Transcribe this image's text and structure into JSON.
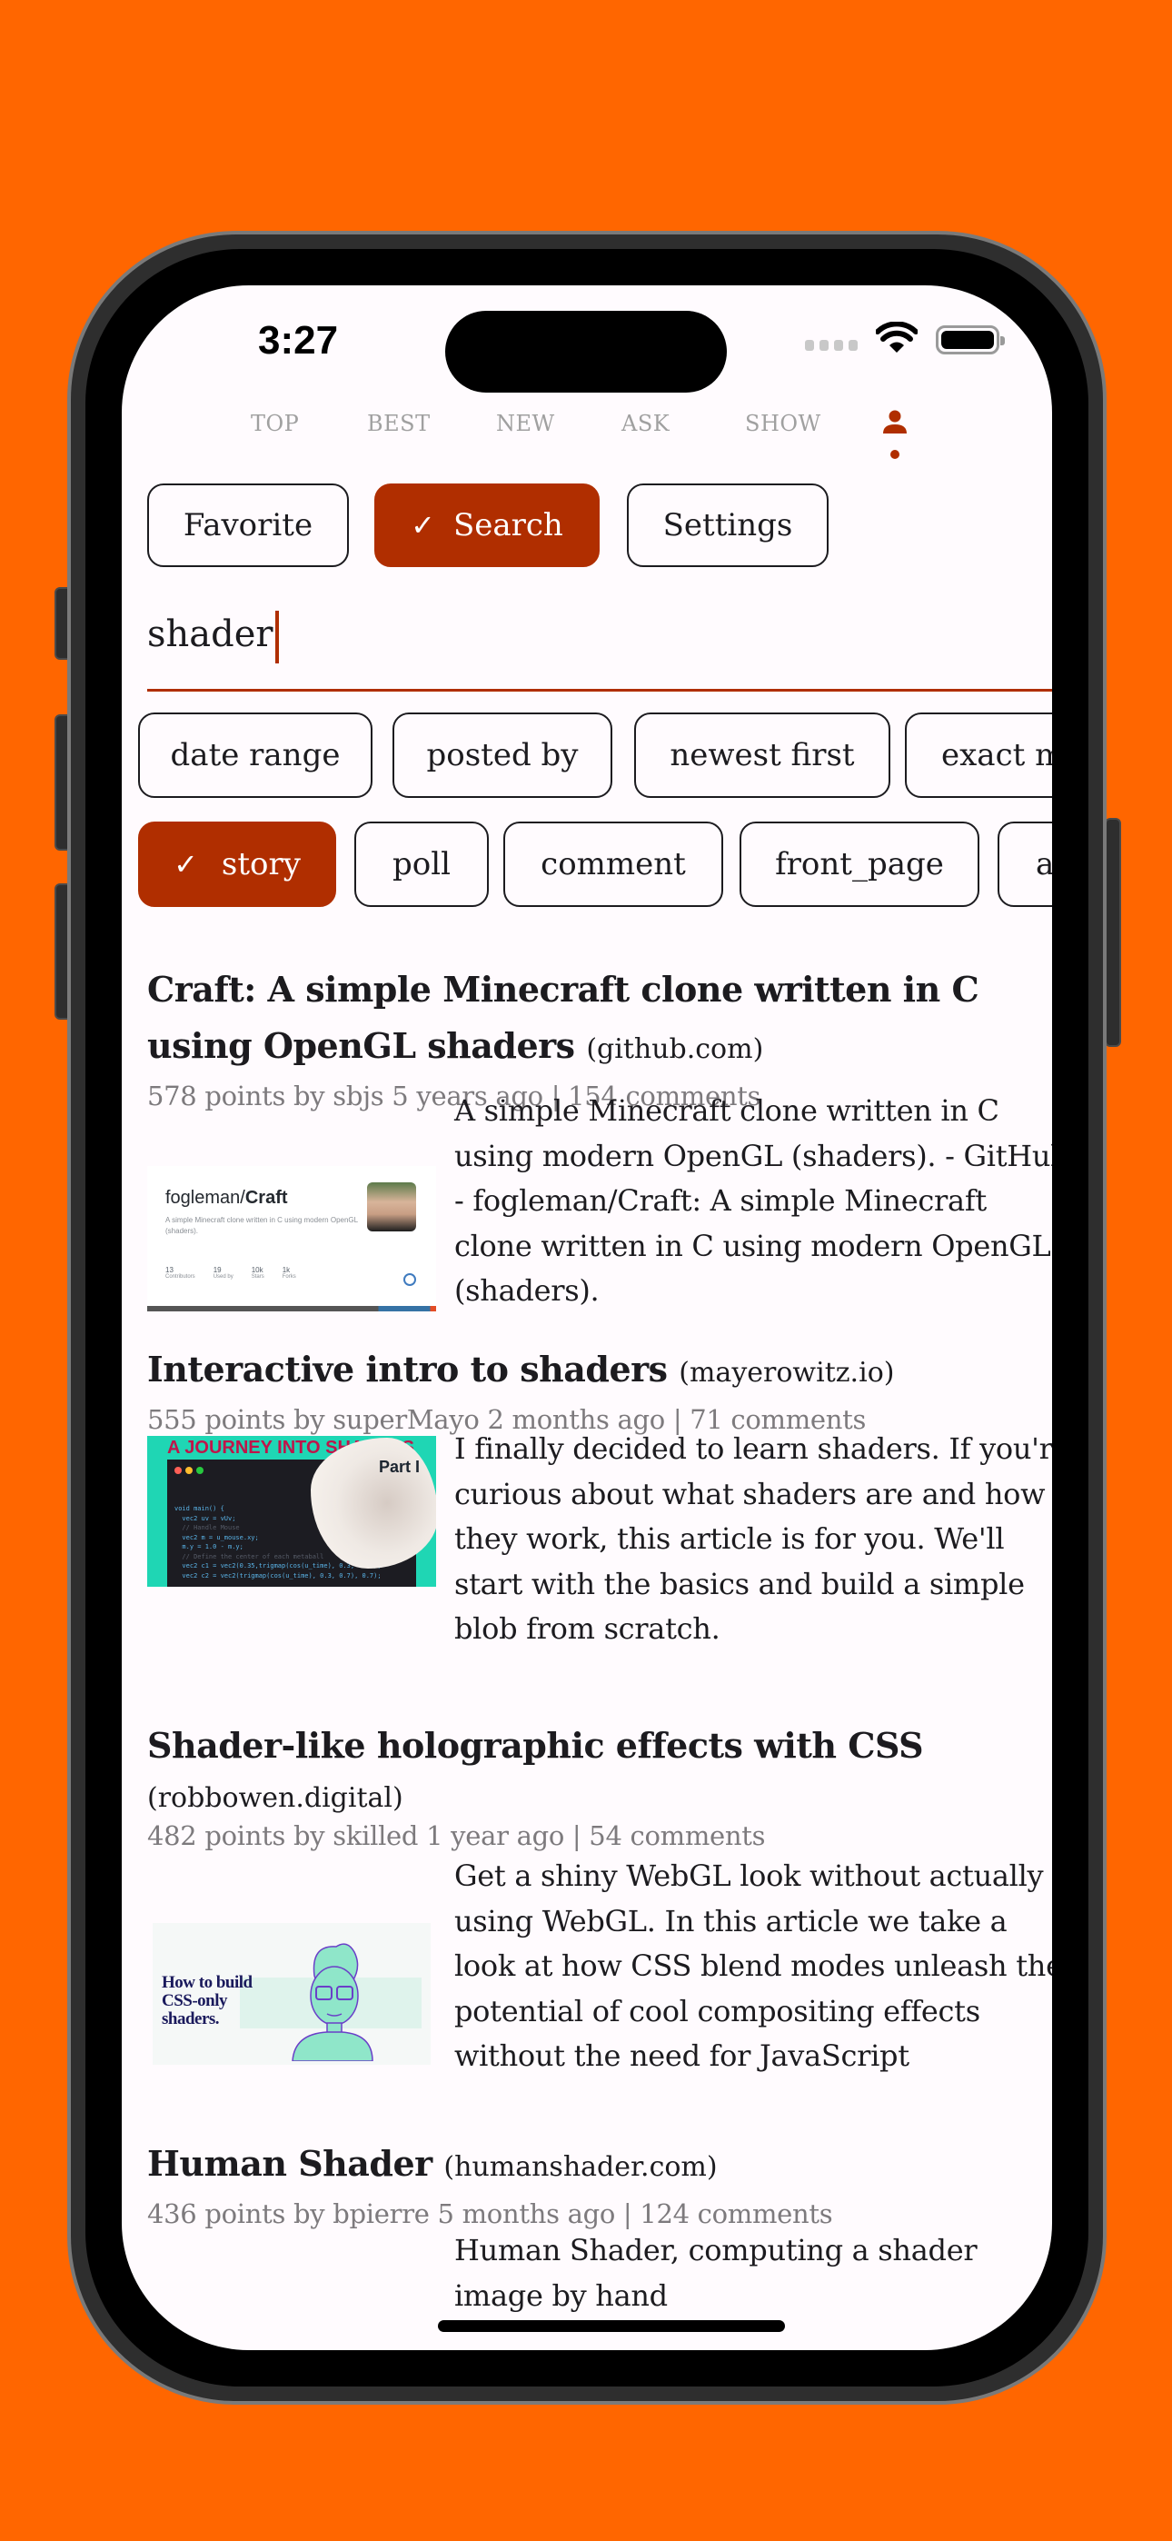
{
  "status_bar": {
    "time": "3:27"
  },
  "top_nav": {
    "tabs": [
      {
        "label": "TOP"
      },
      {
        "label": "BEST"
      },
      {
        "label": "NEW"
      },
      {
        "label": "ASK"
      },
      {
        "label": "SHOW"
      }
    ],
    "active_icon": "person-icon"
  },
  "segments": [
    {
      "label": "Favorite",
      "selected": false
    },
    {
      "label": "Search",
      "selected": true
    },
    {
      "label": "Settings",
      "selected": false
    }
  ],
  "search": {
    "value": "shader"
  },
  "filter_chips": [
    {
      "label": "date range"
    },
    {
      "label": "posted by"
    },
    {
      "label": "newest first"
    },
    {
      "label": "exact mat"
    }
  ],
  "tag_chips": [
    {
      "label": "story",
      "selected": true
    },
    {
      "label": "poll",
      "selected": false
    },
    {
      "label": "comment",
      "selected": false
    },
    {
      "label": "front_page",
      "selected": false
    },
    {
      "label": "ask",
      "selected": false
    }
  ],
  "colors": {
    "accent": "#b02e00",
    "background": "#ff6600",
    "screen": "#fffbfe",
    "meta_text": "#7d7a7d"
  },
  "stories": [
    {
      "title": "Craft: A simple Minecraft clone written in C using OpenGL shaders",
      "domain": "(github.com)",
      "meta": "578 points by sbjs 5 years ago | 154 comments",
      "description": "A simple Minecraft clone written in C using modern OpenGL (shaders). - GitHub - fogleman/Craft: A simple Minecraft clone written in C using modern OpenGL (shaders).",
      "thumb": {
        "repo_owner": "fogleman/",
        "repo_name": "Craft",
        "repo_desc": "A simple Minecraft clone written in C using modern OpenGL (shaders).",
        "stats": [
          {
            "value": "13",
            "label": "Contributors"
          },
          {
            "value": "19",
            "label": "Used by"
          },
          {
            "value": "10k",
            "label": "Stars"
          },
          {
            "value": "1k",
            "label": "Forks"
          }
        ]
      }
    },
    {
      "title": "Interactive intro to shaders",
      "domain": "(mayerowitz.io)",
      "meta": "555 points by superMayo 2 months ago | 71 comments",
      "description": "I finally decided to learn shaders. If you're curious about what shaders are and how they work, this article is for you. We'll start with the basics and build a simple blob from scratch.",
      "thumb": {
        "heading": "A JOURNEY INTO SHADERS",
        "subheading": "Part I",
        "code": [
          "void main() {",
          "  vec2 uv = vUv;",
          "",
          "  // Handle Mouse",
          "  vec2 m = u_mouse.xy;",
          "  m.y = 1.0 - m.y;",
          "",
          "  // Define the center of each metaball",
          "  vec2 c1 = vec2(0.35,trigmap(cos(u_time), 0.3, 0.7));",
          "  vec2 c2 = vec2(trigmap(cos(u_time), 0.3, 0.7), 0.7);"
        ]
      }
    },
    {
      "title": "Shader-like holographic effects with CSS",
      "domain": "(robbowen.digital)",
      "meta": "482 points by skilled 1 year ago | 54 comments",
      "description": "Get a shiny WebGL look without actually using WebGL. In this article we take a look at how CSS blend modes unleash the potential of cool compositing effects without the need for JavaScript",
      "thumb": {
        "heading": "How to build CSS-only shaders."
      }
    },
    {
      "title": "Human Shader",
      "domain": "(humanshader.com)",
      "meta": "436 points by bpierre 5 months ago | 124 comments",
      "description": "Human Shader, computing a shader image by hand"
    }
  ]
}
